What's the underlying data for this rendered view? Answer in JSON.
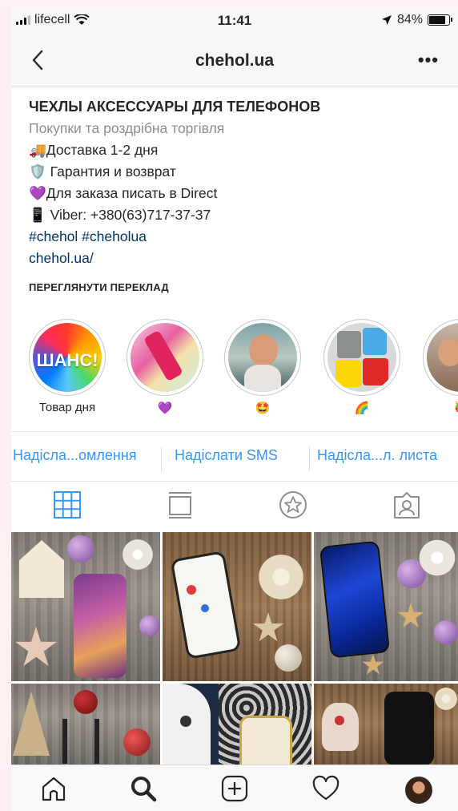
{
  "status_bar": {
    "carrier": "lifecell",
    "time": "11:41",
    "battery": "84%"
  },
  "nav": {
    "title": "chehol.ua",
    "more": "•••"
  },
  "bio": {
    "name": "ЧЕХЛЫ АКСЕССУАРЫ ДЛЯ ТЕЛЕФОНОВ",
    "category": "Покупки та роздрібна торгівля",
    "lines": [
      {
        "emoji": "🚚",
        "text": "Доставка 1-2 дня"
      },
      {
        "emoji": "🛡️",
        "text": "Гарантия и возврат"
      },
      {
        "emoji": "💜",
        "text": "Для заказа писать в Direct"
      },
      {
        "emoji": "📱",
        "text": "Viber: +380(63)717-37-37"
      }
    ],
    "hashtags": "#chehol #cheholua",
    "website": "chehol.ua/"
  },
  "translate_label": "ПЕРЕГЛЯНУТИ ПЕРЕКЛАД",
  "highlights": [
    {
      "label": "Товар дня",
      "cover_text": "ШАНС!"
    },
    {
      "label": "💜"
    },
    {
      "label": "🤩"
    },
    {
      "label": "🌈"
    },
    {
      "label": "🍓"
    }
  ],
  "contacts": {
    "message": "Надісла...омлення",
    "sms": "Надіслати SMS",
    "email": "Надісла...л. листа"
  },
  "tabs": [
    "grid-icon",
    "feed-icon",
    "saved-star-icon",
    "tagged-icon"
  ],
  "colors": {
    "accent": "#3897f0",
    "link": "#003569",
    "muted": "#8e8e8e"
  }
}
